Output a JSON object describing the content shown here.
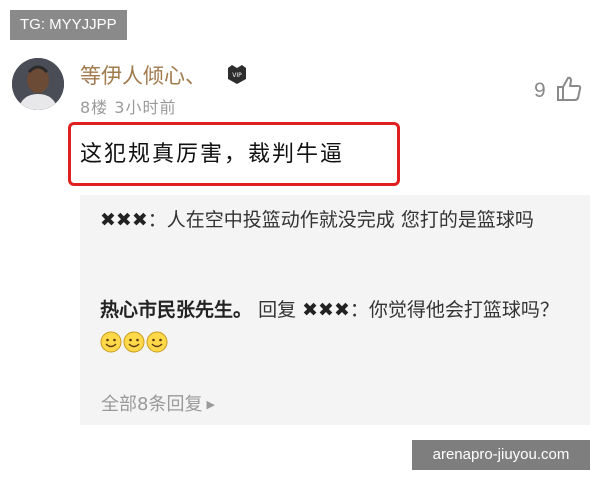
{
  "watermark_top": "TG: MYYJJPP",
  "watermark_bottom": "arenapro-jiuyou.com",
  "comment": {
    "username": "等伊人倾心、",
    "floor": "8楼",
    "time": "3小时前",
    "likes": "9",
    "text": "这犯规真厉害，裁判牛逼"
  },
  "replies": [
    {
      "author": "✖✖✖",
      "separator": "：",
      "text": "人在空中投篮动作就没完成 您打的是篮球吗"
    },
    {
      "author": "热心市民张先生。",
      "reply_word": "回复",
      "target": "✖✖✖",
      "separator": "：",
      "text": "你觉得他会打篮球吗？"
    }
  ],
  "all_replies_label": "全部8条回复",
  "colors": {
    "username": "#a17b4e",
    "highlight_border": "#e02020",
    "reply_bg": "#f4f4f4"
  }
}
